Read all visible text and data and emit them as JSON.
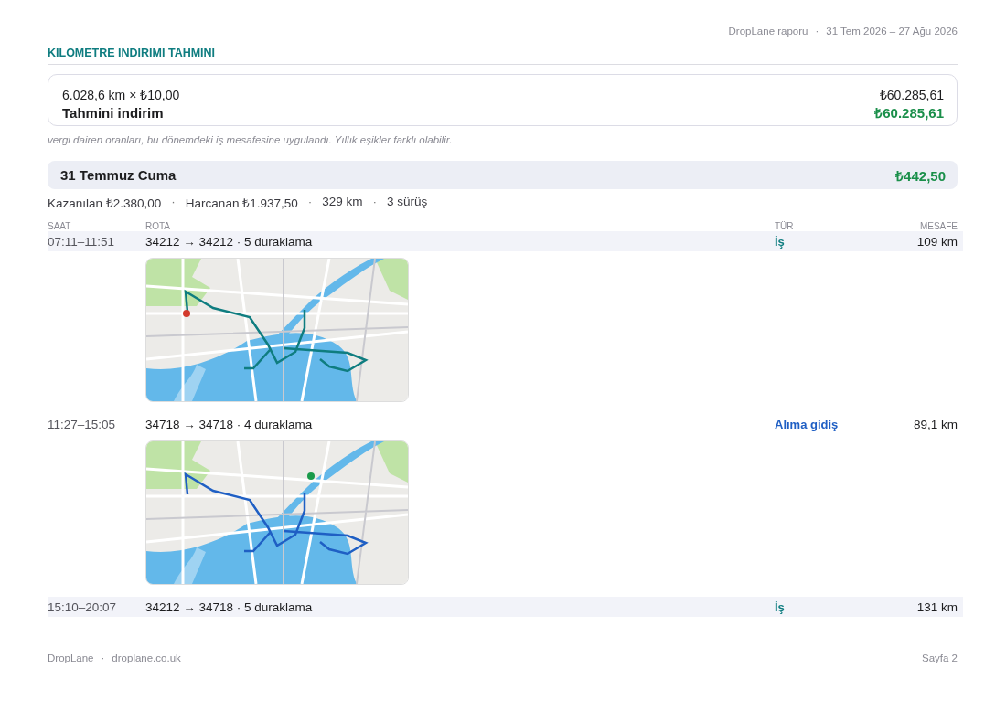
{
  "header": {
    "brand": "DropLane raporu",
    "separator": "·",
    "period": "31 Tem 2026 – 27 Ağu 2026"
  },
  "section_title": "KILOMETRE INDIRIMI TAHMINI",
  "summary": {
    "calc_label": "6.028,6 km × ₺10,00",
    "calc_value": "₺60.285,61",
    "total_label": "Tahmini indirim",
    "total_value": "₺60.285,61"
  },
  "note": "vergi dairen oranları, bu dönemdeki iş mesafesine uygulandı. Yıllık eşikler farklı olabilir.",
  "day": {
    "title": "31 Temmuz Cuma",
    "amount": "₺442,50",
    "stats": [
      "Kazanılan ₺2.380,00",
      "Harcanan ₺1.937,50",
      "329 km",
      "3 sürüş"
    ],
    "stats_separator": "·"
  },
  "table": {
    "columns": [
      "SAAT",
      "ROTA",
      "TÜR",
      "MESAFE"
    ],
    "rows": [
      {
        "time": "07:11–11:51",
        "route": "34212 → 34212 · 5 duraklama",
        "type": "İş",
        "kind": "business",
        "distance": "109 km"
      },
      {
        "time": "11:27–15:05",
        "route": "34718 → 34718 · 4 duraklama",
        "type": "Alıma gidiş",
        "kind": "pickup",
        "distance": "89,1 km"
      },
      {
        "time": "15:10–20:07",
        "route": "34212 → 34718 · 5 duraklama",
        "type": "İş",
        "kind": "business",
        "distance": "131 km"
      }
    ]
  },
  "footer": {
    "brand": "DropLane",
    "separator": "·",
    "site": "droplane.co.uk",
    "page": "Sayfa 2"
  }
}
